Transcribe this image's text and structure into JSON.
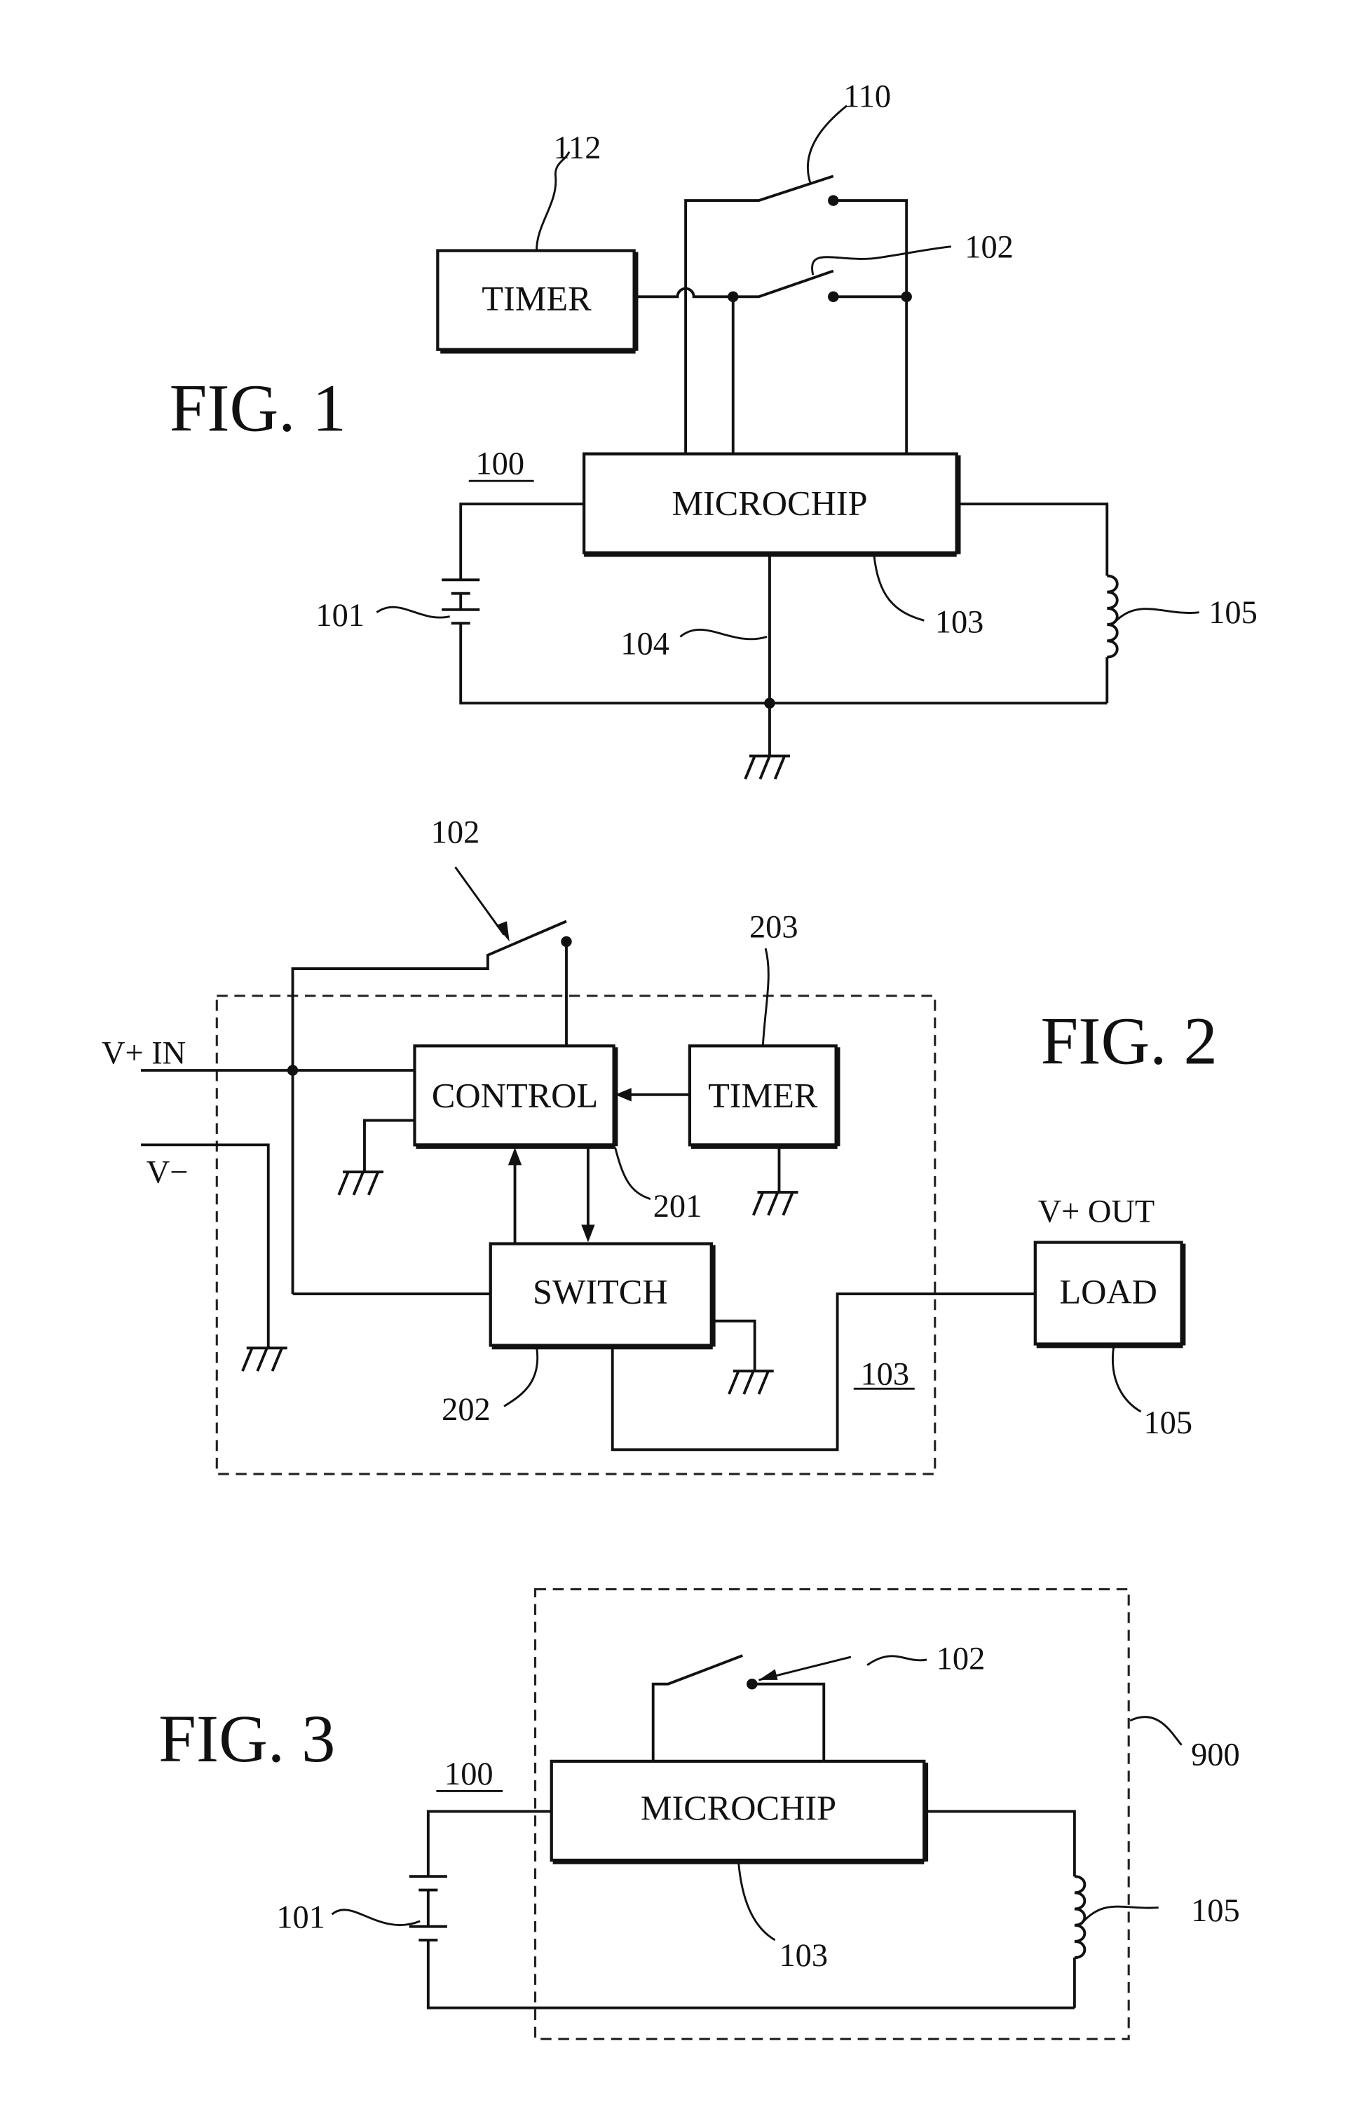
{
  "fig1": {
    "title": "FIG. 1",
    "timer": "TIMER",
    "microchip": "MICROCHIP",
    "refs": {
      "r112": "112",
      "r110": "110",
      "r102": "102",
      "r100": "100",
      "r101": "101",
      "r104": "104",
      "r103": "103",
      "r105": "105"
    }
  },
  "fig2": {
    "title": "FIG. 2",
    "control": "CONTROL",
    "timer": "TIMER",
    "switch": "SWITCH",
    "load": "LOAD",
    "v_plus_in": "V+  IN",
    "v_minus": "V−",
    "v_plus_out": "V+  OUT",
    "refs": {
      "r102": "102",
      "r203": "203",
      "r201": "201",
      "r202": "202",
      "r103": "103",
      "r105": "105"
    }
  },
  "fig3": {
    "title": "FIG. 3",
    "microchip": "MICROCHIP",
    "refs": {
      "r102": "102",
      "r900": "900",
      "r100": "100",
      "r101": "101",
      "r103": "103",
      "r105": "105"
    }
  }
}
